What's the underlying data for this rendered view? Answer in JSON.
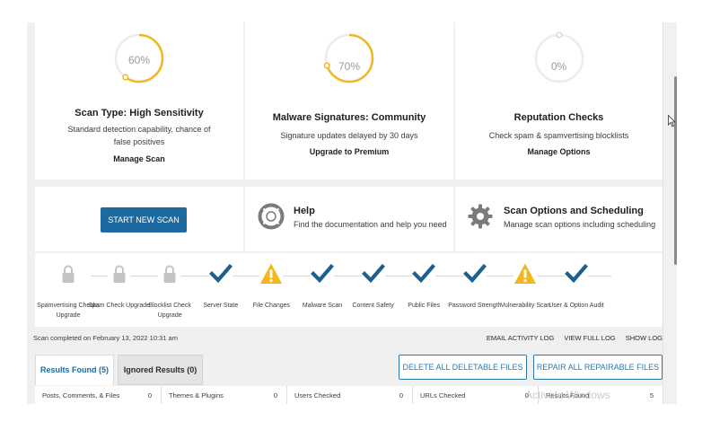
{
  "gauges": [
    {
      "percent_label": "60%",
      "percent": 60,
      "title": "Scan Type: High Sensitivity",
      "description": "Standard detection capability, chance of false positives",
      "link": "Manage Scan",
      "color": "#f2b71f"
    },
    {
      "percent_label": "70%",
      "percent": 70,
      "title": "Malware Signatures: Community",
      "description": "Signature updates delayed by 30 days",
      "link": "Upgrade to Premium",
      "color": "#f2b71f"
    },
    {
      "percent_label": "0%",
      "percent": 0,
      "title": "Reputation Checks",
      "description": "Check spam & spamvertising blocklists",
      "link": "Manage Options",
      "color": "#f2b71f"
    }
  ],
  "actions": {
    "start_scan_label": "START NEW SCAN",
    "help": {
      "title": "Help",
      "description": "Find the documentation and help you need",
      "icon": "lifebuoy-icon"
    },
    "options": {
      "title": "Scan Options and Scheduling",
      "description": "Manage scan options including scheduling",
      "icon": "gear-icon"
    }
  },
  "steps": [
    {
      "label": "Spamvertising Checks Upgrade",
      "status": "locked",
      "icon": "lock-icon"
    },
    {
      "label": "Spam Check Upgrade",
      "status": "locked",
      "icon": "lock-icon"
    },
    {
      "label": "Blocklist Check Upgrade",
      "status": "locked",
      "icon": "lock-icon"
    },
    {
      "label": "Server State",
      "status": "ok",
      "icon": "checkmark-icon"
    },
    {
      "label": "File Changes",
      "status": "warning",
      "icon": "warning-icon"
    },
    {
      "label": "Malware Scan",
      "status": "ok",
      "icon": "checkmark-icon"
    },
    {
      "label": "Content Safety",
      "status": "ok",
      "icon": "checkmark-icon"
    },
    {
      "label": "Public Files",
      "status": "ok",
      "icon": "checkmark-icon"
    },
    {
      "label": "Password Strength",
      "status": "ok",
      "icon": "checkmark-icon"
    },
    {
      "label": "Vulnerability Scan",
      "status": "warning",
      "icon": "warning-icon"
    },
    {
      "label": "User & Option Audit",
      "status": "ok",
      "icon": "checkmark-icon"
    }
  ],
  "meta": {
    "scan_completed": "Scan completed on February 13, 2022 10:31 am",
    "email_log": "EMAIL ACTIVITY LOG",
    "view_log": "VIEW FULL LOG",
    "show_log": "SHOW LOG"
  },
  "tabs": {
    "results_found": "Results Found (5)",
    "ignored_results": "Ignored Results (0)"
  },
  "buttons": {
    "delete_all": "DELETE ALL DELETABLE FILES",
    "repair_all": "REPAIR ALL REPAIRABLE FILES"
  },
  "results": [
    {
      "label": "Posts, Comments, & Files",
      "value": "0"
    },
    {
      "label": "Themes & Plugins",
      "value": "0"
    },
    {
      "label": "Users Checked",
      "value": "0"
    },
    {
      "label": "URLs Checked",
      "value": "0"
    },
    {
      "label": "Results Found",
      "value": "5"
    }
  ],
  "watermark": "Activate Windows",
  "colors": {
    "accent": "#1d6aa0",
    "check": "#1d5f8f",
    "warning": "#f2b71f",
    "lock": "#c4c4c4"
  }
}
